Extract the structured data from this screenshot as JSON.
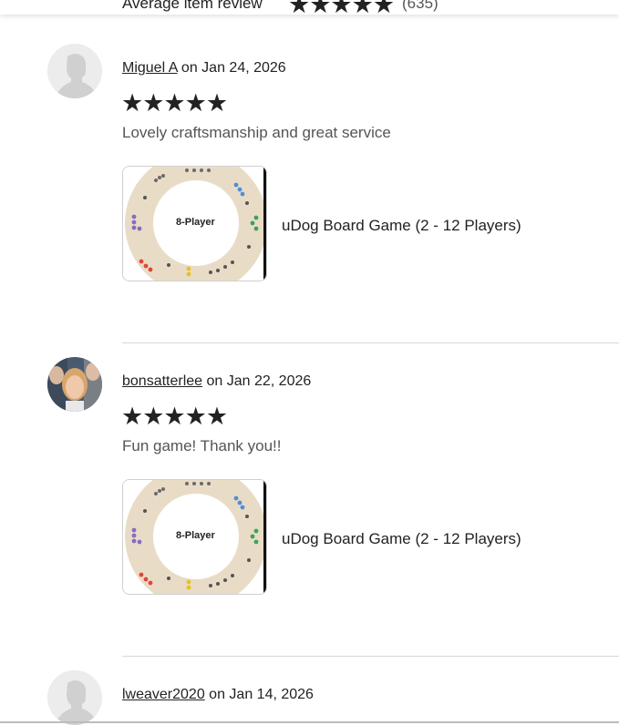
{
  "summary": {
    "label": "Average item review",
    "stars": "★★★★★",
    "count": "(635)"
  },
  "reviews": [
    {
      "author": "Miguel A",
      "date_text": " on Jan 24, 2026",
      "stars": "★★★★★",
      "text": "Lovely craftsmanship and great service",
      "product_title": "uDog Board Game (2 - 12 Players)",
      "thumb_label": "8-Player",
      "avatar": "default-avatar"
    },
    {
      "author": "bonsatterlee",
      "date_text": " on Jan 22, 2026",
      "stars": "★★★★★",
      "text": "Fun game! Thank you!!",
      "product_title": "uDog Board Game (2 - 12 Players)",
      "thumb_label": "8-Player",
      "avatar": "photo-avatar"
    },
    {
      "author": "lweaver2020",
      "date_text": " on Jan 14, 2026",
      "avatar": "default-avatar"
    }
  ],
  "colors": {
    "text": "#222222",
    "muted": "#555555",
    "divider": "#d8d8d8",
    "board": "#e9dcc7"
  }
}
